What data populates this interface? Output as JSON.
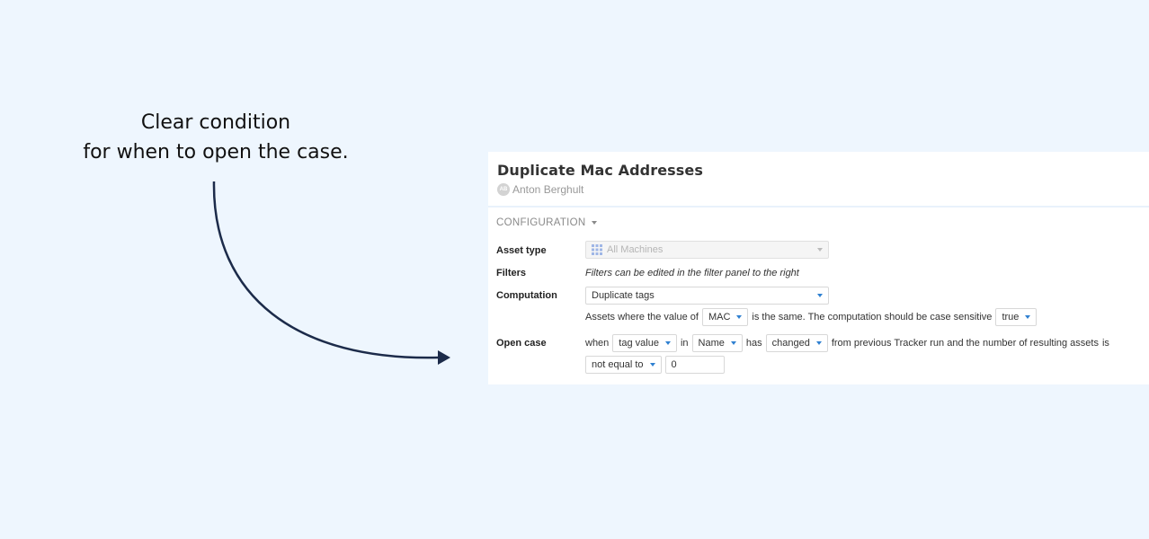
{
  "callout": {
    "line1": "Clear condition",
    "line2": "for when to open the case."
  },
  "panel": {
    "title": "Duplicate Mac Addresses",
    "author_initials": "AB",
    "author": "Anton Berghult",
    "section": "CONFIGURATION"
  },
  "asset_type": {
    "label": "Asset type",
    "value": "All Machines",
    "icon": "grid-icon"
  },
  "filters": {
    "label": "Filters",
    "text": "Filters can be edited in the filter panel to the right"
  },
  "computation": {
    "label": "Computation",
    "value": "Duplicate tags",
    "desc_prefix": "Assets where the value of",
    "tag": "MAC",
    "desc_middle": "is the same. The computation should be case sensitive",
    "case_sensitive": "true"
  },
  "open_case": {
    "label": "Open case",
    "when": "when",
    "source": "tag value",
    "in": "in",
    "tag": "Name",
    "has": "has",
    "change": "changed",
    "suffix": "from previous Tracker run and the number of resulting assets",
    "is": "is",
    "operator": "not equal to",
    "threshold": "0"
  },
  "colors": {
    "background": "#eef6fe",
    "accent": "#2f80d1",
    "arrow": "#1c2b4a"
  }
}
